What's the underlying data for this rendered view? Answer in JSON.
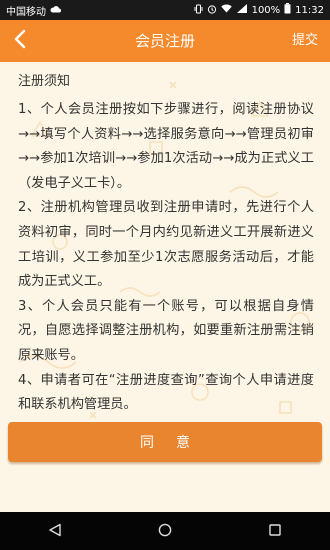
{
  "status_bar": {
    "carrier": "中国移动",
    "battery": "100%",
    "time": "11:32",
    "icons": [
      "cloud-icon",
      "vibrate-icon",
      "alarm-icon",
      "wifi-icon",
      "signal-icon",
      "battery-icon"
    ]
  },
  "header": {
    "back_icon": "chevron-left-icon",
    "title": "会员注册",
    "submit_label": "提交"
  },
  "notice": {
    "title": "注册须知",
    "rules": [
      "1、个人会员注册按如下步骤进行，阅读注册协议→→填写个人资料→→选择服务意向→→管理员初审→→参加1次培训→→参加1次活动→→成为正式义工（发电子义工卡）。",
      "2、注册机构管理员收到注册申请时，先进行个人资料初审，同时一个月内约见新进义工开展新进义工培训，义工参加至少1次志愿服务活动后，才能成为正式义工。",
      "3、个人会员只能有一个账号，可以根据自身情况，自愿选择调整注册机构，如要重新注册需注销原来账号。",
      "4、申请者可在“注册进度查询”查询个人申请进度和联系机构管理员。"
    ]
  },
  "agree_label": "同意",
  "system_nav": {
    "icons": [
      "back-triangle-icon",
      "home-circle-icon",
      "recents-square-icon"
    ]
  },
  "colors": {
    "header_bg": "#f58a2c",
    "button_bg": "#e9852f",
    "page_bg": "#fdf6e6",
    "text": "#333333"
  }
}
